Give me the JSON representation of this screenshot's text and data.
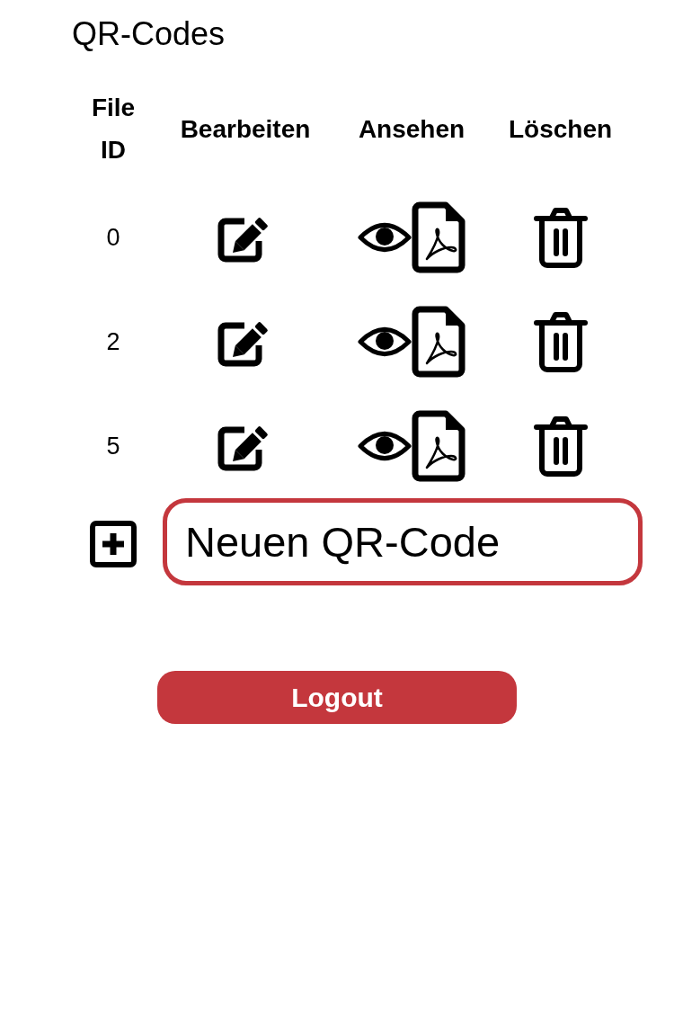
{
  "title": "QR-Codes",
  "table": {
    "columns": [
      "File ID",
      "Bearbeiten",
      "Ansehen",
      "Löschen"
    ],
    "rows": [
      {
        "file_id": "0"
      },
      {
        "file_id": "2"
      },
      {
        "file_id": "5"
      }
    ]
  },
  "new_code": {
    "value": "Neuen QR-Code"
  },
  "logout_button": "Logout"
}
